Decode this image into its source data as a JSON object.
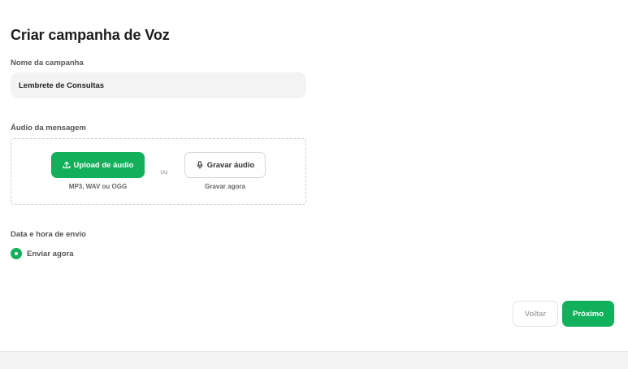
{
  "page": {
    "title": "Criar campanha de Voz"
  },
  "campaign_name": {
    "label": "Nome da campanha",
    "value": "Lembrete de Consultas"
  },
  "audio": {
    "label": "Áudio da mensagem",
    "upload_button": "Upload de áudio",
    "upload_icon": "upload-icon",
    "upload_hint": "MP3, WAV ou OGG",
    "separator": "ou",
    "record_button": "Gravar áudio",
    "record_icon": "microphone-icon",
    "record_hint": "Gravar agora"
  },
  "schedule": {
    "label": "Data e hora de envio",
    "option": "Enviar agora",
    "selected": true
  },
  "actions": {
    "back": "Voltar",
    "next": "Próximo"
  },
  "colors": {
    "accent": "#12b05a"
  }
}
